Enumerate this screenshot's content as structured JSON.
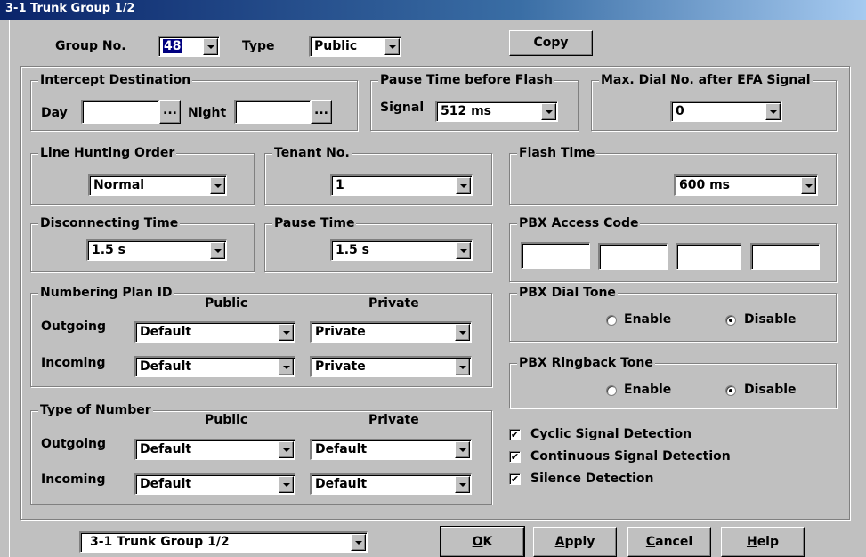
{
  "window": {
    "title": "3-1 Trunk Group 1/2"
  },
  "top": {
    "group_no_label": "Group No.",
    "group_no_value": "48",
    "type_label": "Type",
    "type_value": "Public",
    "copy_label": "Copy"
  },
  "intercept": {
    "legend": "Intercept Destination",
    "day_label": "Day",
    "day_value": "",
    "night_label": "Night",
    "night_value": "",
    "browse_label": "..."
  },
  "pause_flash": {
    "legend": "Pause Time before Flash",
    "signal_label": "Signal",
    "value": "512 ms"
  },
  "max_dial": {
    "legend": "Max. Dial No. after EFA Signal",
    "value": "0"
  },
  "line_hunting": {
    "legend": "Line Hunting Order",
    "value": "Normal"
  },
  "tenant": {
    "legend": "Tenant No.",
    "value": "1"
  },
  "flash_time": {
    "legend": "Flash Time",
    "value": "600 ms"
  },
  "disconnecting": {
    "legend": "Disconnecting Time",
    "value": "1.5 s"
  },
  "pause_time": {
    "legend": "Pause Time",
    "value": "1.5 s"
  },
  "pbx_access": {
    "legend": "PBX Access Code",
    "codes": [
      "",
      "",
      "",
      ""
    ]
  },
  "numbering_plan": {
    "legend": "Numbering Plan ID",
    "public_header": "Public",
    "private_header": "Private",
    "outgoing_label": "Outgoing",
    "incoming_label": "Incoming",
    "outgoing_public": "Default",
    "outgoing_private": "Private",
    "incoming_public": "Default",
    "incoming_private": "Private"
  },
  "type_of_number": {
    "legend": "Type of Number",
    "public_header": "Public",
    "private_header": "Private",
    "outgoing_label": "Outgoing",
    "incoming_label": "Incoming",
    "outgoing_public": "Default",
    "outgoing_private": "Default",
    "incoming_public": "Default",
    "incoming_private": "Default"
  },
  "pbx_dial_tone": {
    "legend": "PBX Dial Tone",
    "enable_label": "Enable",
    "disable_label": "Disable",
    "selected": "Disable"
  },
  "pbx_ringback_tone": {
    "legend": "PBX Ringback Tone",
    "enable_label": "Enable",
    "disable_label": "Disable",
    "selected": "Disable"
  },
  "checks": [
    {
      "label": "Cyclic Signal Detection",
      "checked": true
    },
    {
      "label": "Continuous Signal Detection",
      "checked": true
    },
    {
      "label": "Silence Detection",
      "checked": true
    }
  ],
  "footer": {
    "page_select": "3-1 Trunk Group 1/2",
    "ok_key": "O",
    "ok_rest": "K",
    "apply_key": "A",
    "apply_rest": "pply",
    "cancel_key": "C",
    "cancel_rest": "ancel",
    "help_key": "H",
    "help_rest": "elp"
  },
  "colors": {
    "face": "#c0c0c0",
    "title_bar": "#0a246a",
    "highlight": "#000080"
  }
}
